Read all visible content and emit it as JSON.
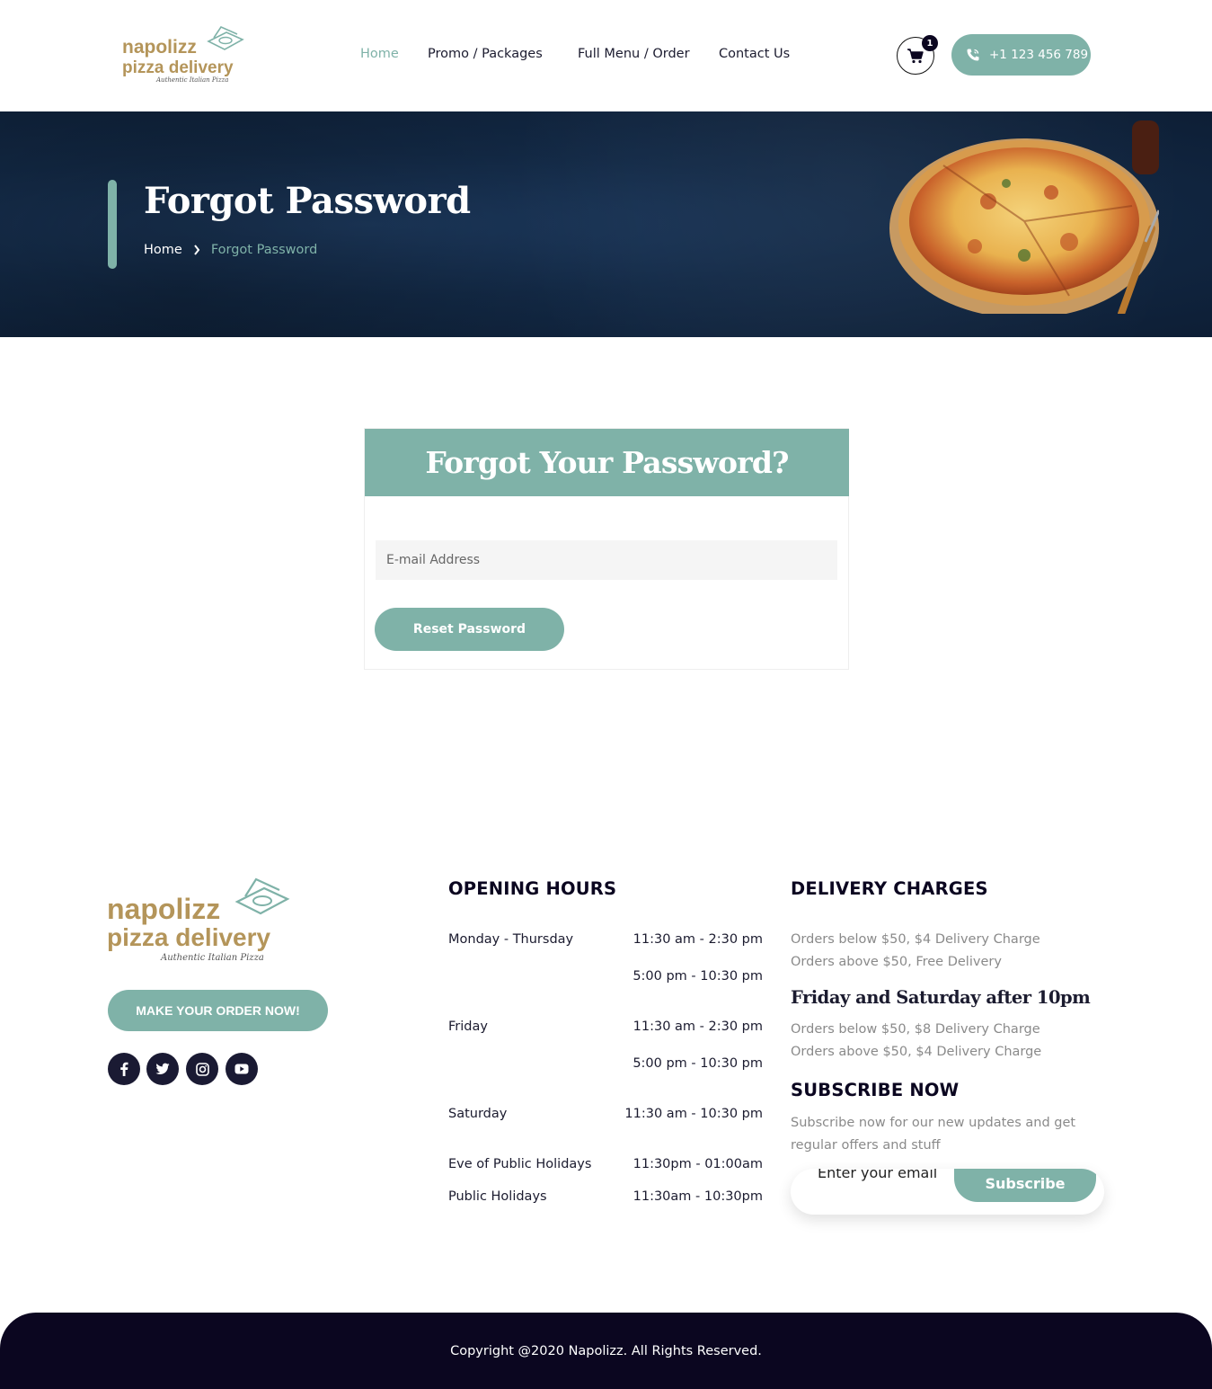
{
  "brand": {
    "logo_line1": "napolizz",
    "logo_line2": "pizza delivery",
    "logo_tagline": "Authentic Italian Pizza"
  },
  "nav": {
    "items": [
      {
        "label": "Home",
        "active": true
      },
      {
        "label": "Promo / Packages",
        "active": false
      },
      {
        "label": "Full Menu / Order",
        "active": false
      },
      {
        "label": "Contact Us",
        "active": false
      }
    ]
  },
  "cart": {
    "count": "1",
    "icon": "cart-icon"
  },
  "phone": {
    "label": "+1 123 456 789",
    "icon": "phone-icon"
  },
  "hero": {
    "title": "Forgot Password",
    "breadcrumb": {
      "home": "Home",
      "current": "Forgot Password"
    }
  },
  "form": {
    "heading": "Forgot Your Password?",
    "email_placeholder": "E-mail Address",
    "submit_label": "Reset Password"
  },
  "footer": {
    "order_button": "MAKE YOUR ORDER NOW!",
    "social_icons": [
      "facebook-icon",
      "twitter-icon",
      "instagram-icon",
      "youtube-icon"
    ],
    "opening_hours": {
      "heading": "OPENING HOURS",
      "rows": [
        {
          "day": "Monday - Thursday",
          "times": [
            "11:30 am - 2:30 pm",
            "5:00 pm - 10:30 pm"
          ]
        },
        {
          "day": "Friday",
          "times": [
            "11:30 am - 2:30 pm",
            "5:00 pm - 10:30 pm"
          ]
        },
        {
          "day": "Saturday",
          "times": [
            "11:30 am - 10:30 pm"
          ]
        },
        {
          "day": "Eve of Public Holidays",
          "times": [
            "11:30pm - 01:00am"
          ]
        },
        {
          "day": "Public Holidays",
          "times": [
            "11:30am - 10:30pm"
          ]
        }
      ]
    },
    "delivery": {
      "heading": "DELIVERY CHARGES",
      "lines": [
        "Orders below $50, $4 Delivery Charge",
        "Orders above $50, Free Delivery"
      ],
      "sub_heading": "Friday and Saturday after 10pm",
      "sub_lines": [
        "Orders below $50, $8 Delivery Charge",
        "Orders above $50, $4 Delivery Charge"
      ]
    },
    "subscribe": {
      "heading": "SUBSCRIBE NOW",
      "text": "Subscribe now for our new updates and get regular offers and stuff",
      "placeholder": "Enter your email",
      "button": "Subscribe"
    },
    "copyright": "Copyright @2020 Napolizz. All Rights Reserved."
  },
  "colors": {
    "accent": "#7fb2a8",
    "brand_gold": "#b4955a",
    "dark": "#0b0620",
    "hero_bg": "#132a47"
  }
}
